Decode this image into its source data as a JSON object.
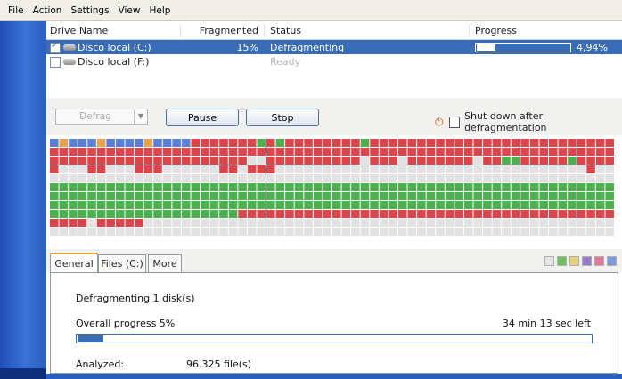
{
  "menu": [
    "File",
    "Action",
    "Settings",
    "View",
    "Help"
  ],
  "drive_list": {
    "headers": {
      "name": "Drive Name",
      "fragmented": "Fragmented",
      "status": "Status",
      "progress": "Progress"
    },
    "rows": [
      {
        "name": "Disco local (C:)",
        "fragmented": "15%",
        "status": "Defragmenting",
        "progress_label": "4,94%",
        "progress_fraction": 0.0494,
        "checked": true,
        "selected": true
      },
      {
        "name": "Disco local (F:)",
        "fragmented": "",
        "status": "Ready",
        "progress_label": "",
        "checked": false,
        "selected": false
      }
    ]
  },
  "toolbar": {
    "defrag_label": "Defrag",
    "pause_label": "Pause",
    "stop_label": "Stop",
    "shutdown_label": "Shut down after defragmentation",
    "shutdown_checked": false
  },
  "disk_map": {
    "cols": 60,
    "colors": {
      "r": "#d9464c",
      "g": "#4caf50",
      "b": "#5a7fd6",
      "o": "#e8a34a",
      "w": "#e2e2e2"
    },
    "rows": [
      "bobbbobbbbobbbbrrrrrrrgrgrrrrrrrrgrrrrrrrrrrrrrrrrrrrrrrrrrr",
      "rrrrrrrrrrrrrrrrrrrrrrrrrrrrrrrrrrrrrrrrrrrrrrrrrrrrrrrrrrrr",
      "rrrrrrrrrrrrrrrrrrrrrwwrrrrrrrrrrwrrrwrrrrrrrwrrggrrrrrgrrrr",
      "rwwwrrwwwrrrwwwwwwrrwrrrwwwwwwwwwwwwwwwwwwwwwwwwwwwwwwwwwrwww",
      "wwwwwwwwwwwwwwwwwwwwwwwwwwwwwwwwwwwwwwwwwwwwwwwwwwwwwwwwwwww",
      "gggggggggggggggggggggggggggggggggggggggggggggggggggggggggggg",
      "gggggggggggggggggggggggggggggggggggggggggggggggggggggggggggg",
      "gggggggggggggggggggggggggggggggggggggggggggggggggggggggggggg",
      "ggggggggggggggggggggrrrrrrrrrrrrrrrrrrrrrrrrrrrrrrrrrrrrrrrr",
      "rrrrwrrrrrwwwwwwwwwwwwwwwwwwwwwwwwwwwwwwwwwwwwwwwwwwwwwwwwww",
      "wwwwwwwwwwwwwwwwwwwwwwwwwwwwwwwwwwwwwwwwwwwwwwwwwwwwwwwwwwww"
    ]
  },
  "tabs": [
    "General",
    "Files (C:)",
    "More"
  ],
  "legend_colors": [
    "#e6e6e6",
    "#6fbf5a",
    "#e3d27a",
    "#9a7ad0",
    "#e07a9a",
    "#7a9ad8"
  ],
  "general": {
    "status_line": "Defragmenting 1 disk(s)",
    "overall_label": "Overall progress 5%",
    "overall_fraction": 0.05,
    "time_left": "34 min 13 sec left",
    "analyzed_label": "Analyzed:",
    "analyzed_value": "96.325 file(s)"
  }
}
